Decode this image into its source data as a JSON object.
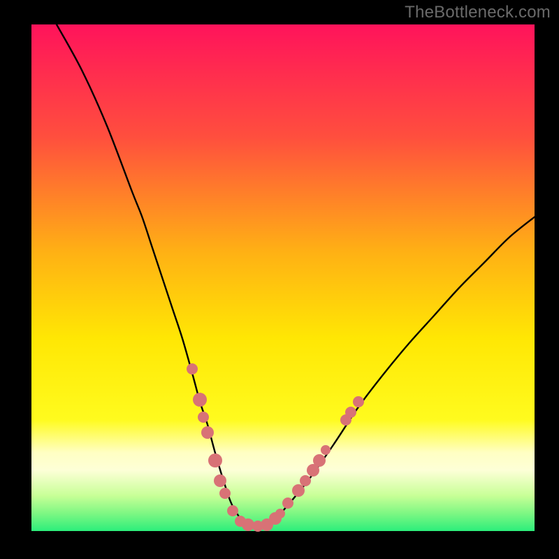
{
  "watermark": "TheBottleneck.com",
  "colors": {
    "bg": "#000000",
    "gradient_top": "#ff135b",
    "gradient_mid1": "#ff8d1f",
    "gradient_mid2": "#fff502",
    "gradient_mid3": "#ffffc1",
    "gradient_bottom1": "#b6ff84",
    "gradient_bottom2": "#2cee7b",
    "curve": "#000000",
    "marker": "#d87276",
    "watermark_text": "#6a6a6a"
  },
  "chart_data": {
    "type": "line",
    "title": "",
    "xlabel": "",
    "ylabel": "",
    "xlim": [
      0,
      100
    ],
    "ylim": [
      0,
      100
    ],
    "grid": false,
    "series": [
      {
        "name": "bottleneck-curve",
        "x": [
          5,
          10,
          15,
          20,
          22,
          24,
          26,
          28,
          30,
          32,
          33.5,
          35,
          36.5,
          38,
          39.5,
          40.5,
          42,
          44,
          46,
          48,
          50,
          55,
          60,
          65,
          70,
          75,
          80,
          85,
          90,
          95,
          100
        ],
        "y": [
          100,
          91,
          80,
          67,
          62,
          56,
          50,
          44,
          38,
          31,
          25.5,
          21,
          15.5,
          10.5,
          6,
          4,
          2,
          1,
          1,
          2,
          4,
          10,
          17,
          24.5,
          31,
          37,
          42.5,
          48,
          53,
          58,
          62
        ]
      }
    ],
    "markers": [
      {
        "x": 32,
        "y": 32,
        "r": 8
      },
      {
        "x": 33.5,
        "y": 26,
        "r": 10
      },
      {
        "x": 34.2,
        "y": 22.5,
        "r": 8
      },
      {
        "x": 35,
        "y": 19.5,
        "r": 9
      },
      {
        "x": 36.5,
        "y": 14,
        "r": 10
      },
      {
        "x": 37.5,
        "y": 10,
        "r": 9
      },
      {
        "x": 38.5,
        "y": 7.5,
        "r": 8
      },
      {
        "x": 40,
        "y": 4,
        "r": 8
      },
      {
        "x": 41.5,
        "y": 2,
        "r": 8
      },
      {
        "x": 43,
        "y": 1.2,
        "r": 9
      },
      {
        "x": 45,
        "y": 1,
        "r": 8
      },
      {
        "x": 46.8,
        "y": 1.2,
        "r": 9
      },
      {
        "x": 48.5,
        "y": 2.5,
        "r": 9
      },
      {
        "x": 49.5,
        "y": 3.5,
        "r": 7
      },
      {
        "x": 51,
        "y": 5.5,
        "r": 8
      },
      {
        "x": 53,
        "y": 8,
        "r": 9
      },
      {
        "x": 54.5,
        "y": 10,
        "r": 8
      },
      {
        "x": 56,
        "y": 12,
        "r": 9
      },
      {
        "x": 57.2,
        "y": 14,
        "r": 9
      },
      {
        "x": 58.5,
        "y": 16,
        "r": 7
      },
      {
        "x": 62.5,
        "y": 22,
        "r": 8
      },
      {
        "x": 63.5,
        "y": 23.5,
        "r": 8
      },
      {
        "x": 65,
        "y": 25.5,
        "r": 8
      }
    ],
    "gradient_stops": [
      {
        "offset": 0,
        "color": "#ff135b"
      },
      {
        "offset": 0.22,
        "color": "#ff4e3e"
      },
      {
        "offset": 0.45,
        "color": "#ffb114"
      },
      {
        "offset": 0.62,
        "color": "#ffe704"
      },
      {
        "offset": 0.78,
        "color": "#fffb1e"
      },
      {
        "offset": 0.845,
        "color": "#ffffc3"
      },
      {
        "offset": 0.88,
        "color": "#fdffd7"
      },
      {
        "offset": 0.93,
        "color": "#c8ff97"
      },
      {
        "offset": 0.965,
        "color": "#7ef783"
      },
      {
        "offset": 1.0,
        "color": "#2cee7b"
      }
    ]
  }
}
